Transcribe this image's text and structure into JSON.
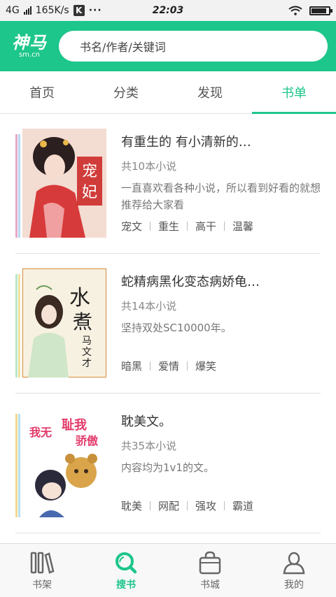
{
  "status_bar": {
    "network": "4G",
    "speed": "165K/s",
    "k_badge": "K",
    "more": "···",
    "time": "22:03",
    "battery_level": 0.8
  },
  "header": {
    "logo_main": "神马",
    "logo_sub": "sm.cn",
    "search_placeholder": "书名/作者/关键词"
  },
  "tabs": [
    {
      "label": "首页"
    },
    {
      "label": "分类"
    },
    {
      "label": "发现"
    },
    {
      "label": "书单",
      "active": true
    }
  ],
  "booklists": [
    {
      "title": "有重生的 有小清新的…",
      "count": "共10本小说",
      "desc": "一直喜欢看各种小说，所以看到好看的就想推荐给大家看",
      "tags": [
        "宠文",
        "重生",
        "高干",
        "温馨"
      ],
      "stripes": [
        "#e6a6c8",
        "#b8d8f0"
      ],
      "cover_title": "宠妃"
    },
    {
      "title": "蛇精病黑化变态病娇龟…",
      "count": "共14本小说",
      "desc": "坚持双处SC10000年。",
      "tags": [
        "暗黑",
        "爱情",
        "爆笑"
      ],
      "stripes": [
        "#b8e8c8",
        "#f0e0a0"
      ],
      "cover_title": "水煮马文才"
    },
    {
      "title": "耽美文。",
      "count": "共35本小说",
      "desc": "内容均为1v1的文。",
      "tags": [
        "耽美",
        "网配",
        "强攻",
        "霸道"
      ],
      "stripes": [
        "#f0d890",
        "#b8e0f0"
      ],
      "cover_title": "我无耻我骄傲"
    }
  ],
  "bottom_nav": [
    {
      "label": "书架",
      "icon": "bookshelf-icon"
    },
    {
      "label": "搜书",
      "icon": "search-book-icon",
      "active": true
    },
    {
      "label": "书城",
      "icon": "bookstore-bag-icon"
    },
    {
      "label": "我的",
      "icon": "profile-icon"
    }
  ],
  "colors": {
    "brand": "#1dc68a",
    "text": "#333333",
    "muted": "#888888"
  }
}
